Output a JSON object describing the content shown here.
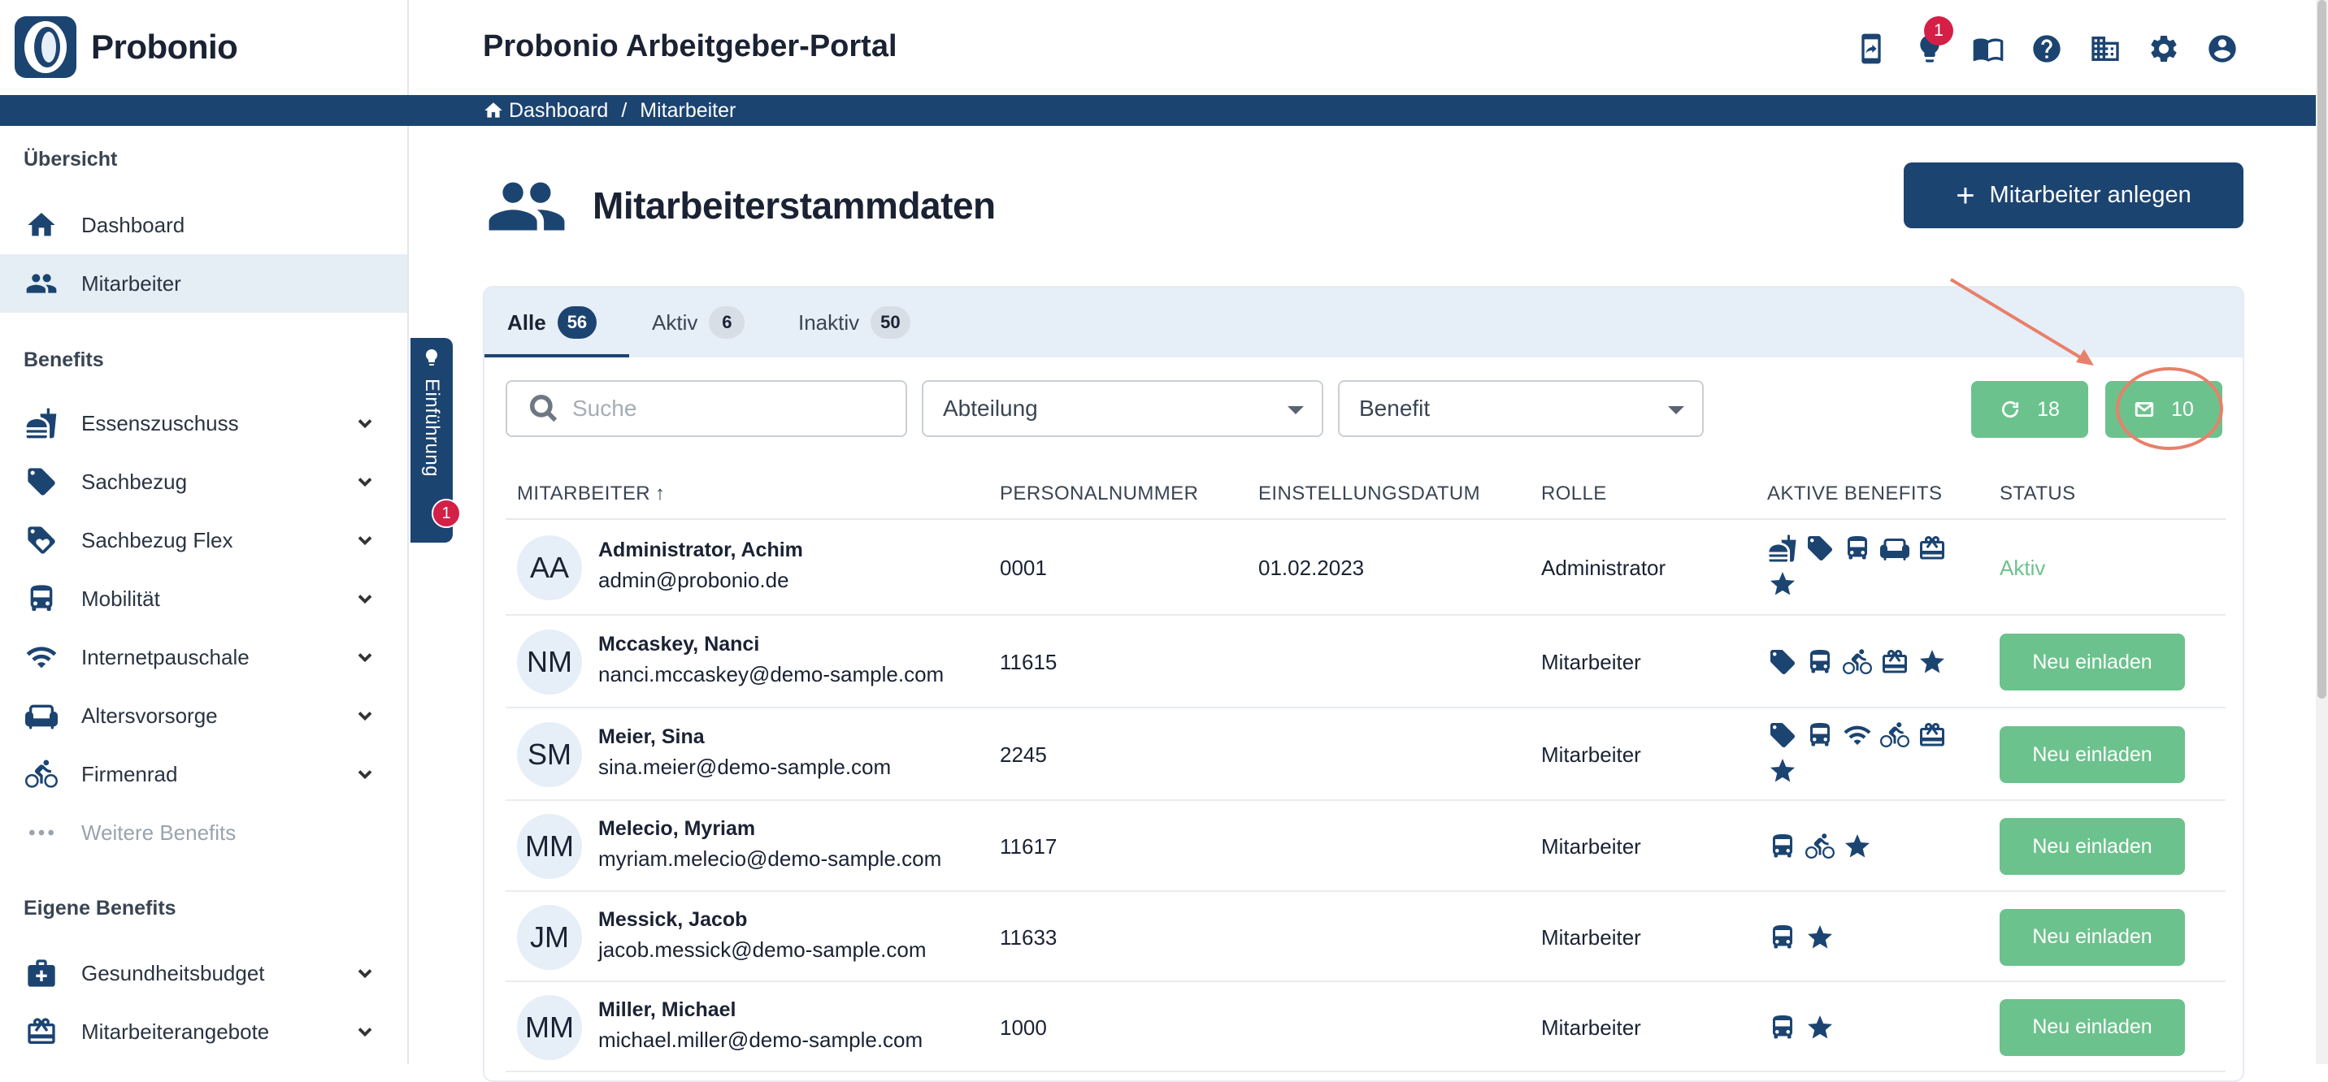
{
  "app": {
    "brand": "Probonio",
    "title": "Probonio Arbeitgeber-Portal",
    "notification_count": "1",
    "top_icons": [
      "mobile-icon",
      "lightbulb-icon",
      "book-icon",
      "help-icon",
      "company-icon",
      "gear-icon",
      "account-icon"
    ]
  },
  "breadcrumb": {
    "home": "Dashboard",
    "separator": "/",
    "current": "Mitarbeiter"
  },
  "sidebar": {
    "section_overview": "Übersicht",
    "overview_items": [
      {
        "label": "Dashboard",
        "icon": "home-icon"
      },
      {
        "label": "Mitarbeiter",
        "icon": "people-icon",
        "active": true
      }
    ],
    "section_benefits": "Benefits",
    "benefit_items": [
      {
        "label": "Essenszuschuss",
        "icon": "food-icon"
      },
      {
        "label": "Sachbezug",
        "icon": "tag-icon"
      },
      {
        "label": "Sachbezug Flex",
        "icon": "tag-flex-icon"
      },
      {
        "label": "Mobilität",
        "icon": "bus-icon"
      },
      {
        "label": "Internetpauschale",
        "icon": "wifi-icon"
      },
      {
        "label": "Altersvorsorge",
        "icon": "sofa-icon"
      },
      {
        "label": "Firmenrad",
        "icon": "bike-icon"
      },
      {
        "label": "Weitere Benefits",
        "icon": "more-icon"
      }
    ],
    "section_own": "Eigene Benefits",
    "own_items": [
      {
        "label": "Gesundheitsbudget",
        "icon": "medical-icon"
      },
      {
        "label": "Mitarbeiterangebote",
        "icon": "gift-card-icon"
      }
    ]
  },
  "intro": {
    "label": "Einführung",
    "badge": "1"
  },
  "page": {
    "title": "Mitarbeiterstammdaten",
    "add_button": "Mitarbeiter anlegen"
  },
  "tabs": [
    {
      "label": "Alle",
      "count": "56"
    },
    {
      "label": "Aktiv",
      "count": "6"
    },
    {
      "label": "Inaktiv",
      "count": "50"
    }
  ],
  "filters": {
    "search_placeholder": "Suche",
    "department": "Abteilung",
    "benefit": "Benefit",
    "refresh_count": "18",
    "mail_count": "10"
  },
  "table": {
    "headers": [
      "MITARBEITER",
      "PERSONALNUMMER",
      "EINSTELLUNGSDATUM",
      "ROLLE",
      "AKTIVE BENEFITS",
      "STATUS"
    ],
    "sort_indicator": "↑",
    "rows": [
      {
        "initials": "AA",
        "name": "Administrator, Achim",
        "email": "admin@probonio.de",
        "number": "0001",
        "date": "01.02.2023",
        "role": "Administrator",
        "benefits": [
          "food-icon",
          "tag-icon",
          "bus-icon",
          "sofa-icon",
          "gift-card-icon",
          "star-icon"
        ],
        "status": "Aktiv"
      },
      {
        "initials": "NM",
        "name": "Mccaskey, Nanci",
        "email": "nanci.mccaskey@demo-sample.com",
        "number": "11615",
        "date": "",
        "role": "Mitarbeiter",
        "benefits": [
          "tag-icon",
          "bus-icon",
          "bike-icon",
          "gift-card-icon",
          "star-icon"
        ],
        "status": "Neu einladen"
      },
      {
        "initials": "SM",
        "name": "Meier, Sina",
        "email": "sina.meier@demo-sample.com",
        "number": "2245",
        "date": "",
        "role": "Mitarbeiter",
        "benefits": [
          "tag-icon",
          "bus-icon",
          "wifi-icon",
          "bike-icon",
          "gift-card-icon",
          "star-icon"
        ],
        "status": "Neu einladen"
      },
      {
        "initials": "MM",
        "name": "Melecio, Myriam",
        "email": "myriam.melecio@demo-sample.com",
        "number": "11617",
        "date": "",
        "role": "Mitarbeiter",
        "benefits": [
          "bus-icon",
          "bike-icon",
          "star-icon"
        ],
        "status": "Neu einladen"
      },
      {
        "initials": "JM",
        "name": "Messick, Jacob",
        "email": "jacob.messick@demo-sample.com",
        "number": "11633",
        "date": "",
        "role": "Mitarbeiter",
        "benefits": [
          "bus-icon",
          "star-icon"
        ],
        "status": "Neu einladen"
      },
      {
        "initials": "MM",
        "name": "Miller, Michael",
        "email": "michael.miller@demo-sample.com",
        "number": "1000",
        "date": "",
        "role": "Mitarbeiter",
        "benefits": [
          "bus-icon",
          "star-icon"
        ],
        "status": "Neu einladen"
      }
    ]
  },
  "colors": {
    "primary": "#1c4471",
    "success": "#6cc28c",
    "danger": "#d41f47",
    "annotation": "#e8806a"
  }
}
